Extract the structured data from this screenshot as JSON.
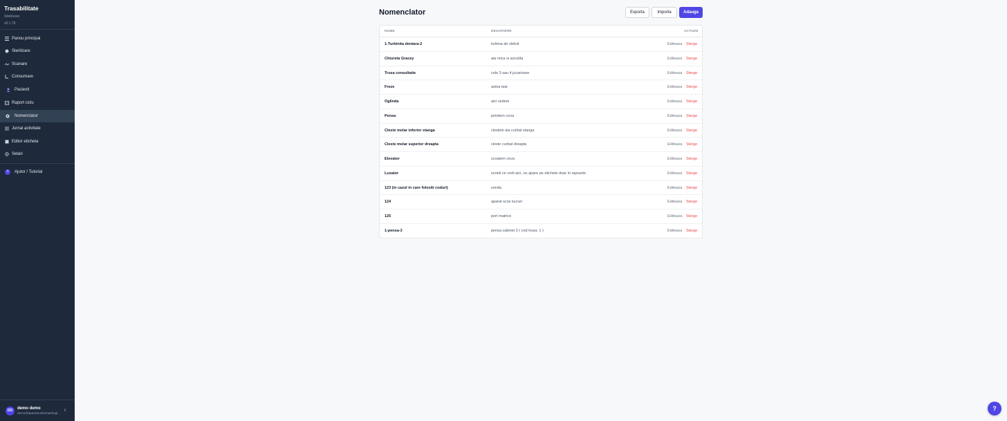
{
  "app": {
    "title": "Trasabilitate",
    "subtitle": "Sterilizare",
    "version": "v0.1.79"
  },
  "sidebar": {
    "items": [
      {
        "label": "Panou principal",
        "icon": "grid-icon",
        "active": false
      },
      {
        "label": "Sterilizare",
        "icon": "sterilize-icon",
        "active": false
      },
      {
        "label": "Scanare",
        "icon": "scan-icon",
        "active": false
      },
      {
        "label": "Consumare",
        "icon": "consume-icon",
        "active": false
      },
      {
        "label": "Pacienti",
        "icon": "user-icon",
        "active": false
      },
      {
        "label": "Raport ciclu",
        "icon": "report-icon",
        "active": false
      },
      {
        "label": "Nomenclator",
        "icon": "gear-icon",
        "active": true
      },
      {
        "label": "Jurnal activitate",
        "icon": "list-icon",
        "active": false
      },
      {
        "label": "Editor eticheta",
        "icon": "label-icon",
        "active": false
      },
      {
        "label": "Setari",
        "icon": "settings-icon",
        "active": false
      }
    ],
    "help": {
      "label": "Ajutor / Tutorial",
      "icon_text": "?"
    }
  },
  "user": {
    "initials": "DD",
    "name": "demo demo",
    "email": "demo@aparaturastomatologica.ro"
  },
  "page": {
    "title": "Nomenclator",
    "buttons": {
      "export": "Exporta",
      "import": "Importa",
      "add": "Adauga"
    }
  },
  "table": {
    "columns": {
      "name": "NUME",
      "description": "DESCRIERE",
      "actions": "ACTIUNI"
    },
    "edit_label": "Editeaza",
    "delete_label": "Sterge",
    "rows": [
      {
        "name": "1-Turbinita dentara-2",
        "description": "turbina de slefuit"
      },
      {
        "name": "Chiureta Gracey",
        "description": "aia mica si ascutita"
      },
      {
        "name": "Trusa consultatie",
        "description": "cele 3 sau 4 jucarioare"
      },
      {
        "name": "Freze",
        "description": "astea taie"
      },
      {
        "name": "Oglinda",
        "description": "aici vedem"
      },
      {
        "name": "Pensa",
        "description": "prindem ceva"
      },
      {
        "name": "Cleste molar inferior stanga",
        "description": "clestele ala curbat stanga"
      },
      {
        "name": "Cleste molar superior dreapta",
        "description": "cleste curbat dreapta"
      },
      {
        "name": "Elevator",
        "description": "scoatem ceva"
      },
      {
        "name": "Luxator",
        "description": "scrieti ce vreti aici, nu apare pe etichete doar in rapoarte"
      },
      {
        "name": "123 (in cazul in care folositi coduri)",
        "description": "sonda"
      },
      {
        "name": "124",
        "description": "aparat scos lucrari"
      },
      {
        "name": "125",
        "description": "port matrice"
      },
      {
        "name": "1-pensa-3",
        "description": "pensa cabinet 3 ( cod trusa: 1 )"
      }
    ]
  },
  "fab": {
    "label": "?"
  },
  "colors": {
    "sidebar_bg": "#1e293b",
    "accent": "#4f46e5",
    "danger": "#ef4444"
  }
}
